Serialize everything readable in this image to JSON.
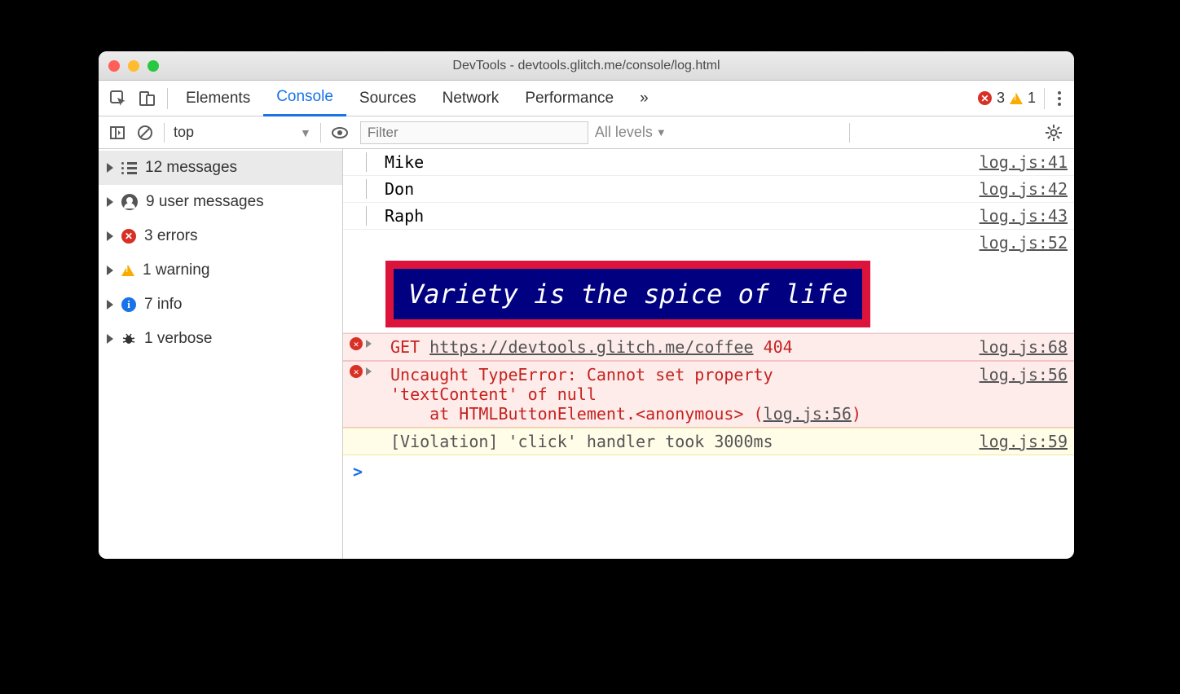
{
  "window": {
    "title": "DevTools - devtools.glitch.me/console/log.html"
  },
  "tabs": {
    "elements": "Elements",
    "console": "Console",
    "sources": "Sources",
    "network": "Network",
    "performance": "Performance",
    "overflow": "»"
  },
  "toolbar_badges": {
    "errors": "3",
    "warnings": "1"
  },
  "subtoolbar": {
    "context": "top",
    "filter_placeholder": "Filter",
    "levels": "All levels"
  },
  "sidebar": {
    "messages": "12 messages",
    "user": "9 user messages",
    "errors": "3 errors",
    "warnings": "1 warning",
    "info": "7 info",
    "verbose": "1 verbose"
  },
  "log": {
    "names": [
      {
        "text": "Mike",
        "src": "log.js:41"
      },
      {
        "text": "Don",
        "src": "log.js:42"
      },
      {
        "text": "Raph",
        "src": "log.js:43"
      }
    ],
    "banner_src": "log.js:52",
    "banner_text": "Variety is the spice of life",
    "http": {
      "method": "GET",
      "url": "https://devtools.glitch.me/coffee",
      "status": "404",
      "src": "log.js:68"
    },
    "exception": {
      "line1": "Uncaught TypeError: Cannot set property",
      "line2": "'textContent' of null",
      "stack_prefix": "    at HTMLButtonElement.",
      "stack_anon": "<anonymous>",
      "stack_paren_link": "log.js:56",
      "src": "log.js:56"
    },
    "violation": {
      "text": "[Violation] 'click' handler took 3000ms",
      "src": "log.js:59"
    },
    "prompt": ">"
  }
}
